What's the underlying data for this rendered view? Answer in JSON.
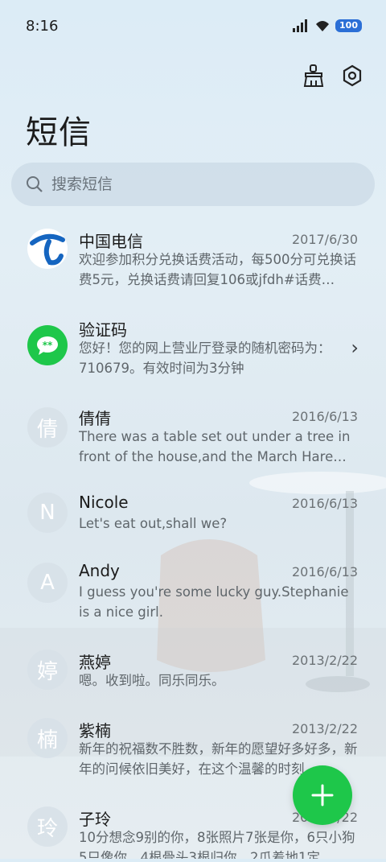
{
  "status": {
    "time": "8:16",
    "battery": "100"
  },
  "header": {
    "title": "短信"
  },
  "search": {
    "placeholder": "搜索短信"
  },
  "conversations": [
    {
      "name": "中国电信",
      "date": "2017/6/30",
      "preview": "欢迎参加积分兑换话费活动，每500分可兑换话费5元，兑换话费请回复106或jfdh#话费…",
      "avatar": "telecom-logo"
    },
    {
      "name": "验证码",
      "date": "",
      "preview": "您好！您的网上营业厅登录的随机密码为：710679。有效时间为3分钟",
      "avatar": "sms-green"
    },
    {
      "name": "倩倩",
      "date": "2016/6/13",
      "preview": "There was a table set out under a tree in front of the house,and the March Hare an…",
      "initial": "倩"
    },
    {
      "name": "Nicole",
      "date": "2016/6/13",
      "preview": "Let's eat out,shall we?",
      "initial": "N"
    },
    {
      "name": "Andy",
      "date": "2016/6/13",
      "preview": "I guess you're some lucky guy.Stephanie is a nice girl.",
      "initial": "A"
    },
    {
      "name": "燕婷",
      "date": "2013/2/22",
      "preview": "嗯。收到啦。同乐同乐。",
      "initial": "婷"
    },
    {
      "name": "紫楠",
      "date": "2013/2/22",
      "preview": "新年的祝福数不胜数，新年的愿望好多好多，新年的问候依旧美好，在这个温馨的时刻…",
      "initial": "楠"
    },
    {
      "name": "子玲",
      "date": "2013/2/22",
      "preview": "10分想念9别的你，8张照片7张是你，6只小狗5只像你，4根骨头3根归你，2爪着地1定…",
      "initial": "玲"
    }
  ],
  "colors": {
    "accent": "#1ec74a",
    "telecom": "#1565c0",
    "battery": "#2b6fd6"
  }
}
